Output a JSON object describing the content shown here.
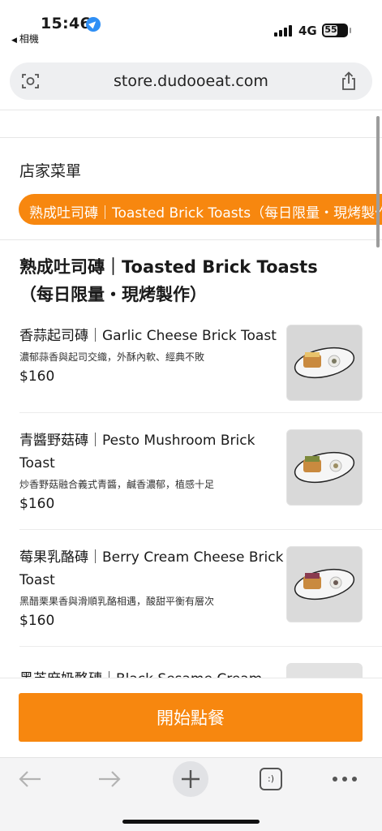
{
  "status_bar": {
    "time": "15:46",
    "back_app": "相機",
    "network": "4G",
    "battery": "55"
  },
  "browser": {
    "url": "store.dudooeat.com"
  },
  "store": {
    "menu_title": "店家菜單",
    "category_tab": "熟成吐司磚｜Toasted Brick Toasts（每日限量・現烤製作）",
    "section_heading": "熟成吐司磚｜Toasted Brick Toasts（每日限量・現烤製作）",
    "items": [
      {
        "name": "香蒜起司磚｜Garlic Cheese Brick Toast",
        "description": "濃郁蒜香與起司交織，外酥內軟、經典不敗",
        "price": "$160"
      },
      {
        "name": "青醬野菇磚｜Pesto Mushroom Brick Toast",
        "description": "炒香野菇融合義式青醬，鹹香濃郁，植感十足",
        "price": "$160"
      },
      {
        "name": "莓果乳酪磚｜Berry Cream Cheese Brick Toast",
        "description": "黑醋栗果香與滑順乳酪相遇，酸甜平衡有層次",
        "price": "$160"
      }
    ],
    "partial_item_name": "黑芝麻奶酪磚｜Black Sesame Cream",
    "order_button": "開始點餐"
  },
  "toolbar": {
    "tabs_label": ":)"
  },
  "colors": {
    "accent": "#f7870f",
    "address_bar": "#eeeff1",
    "toolbar": "#f4f4f5"
  }
}
